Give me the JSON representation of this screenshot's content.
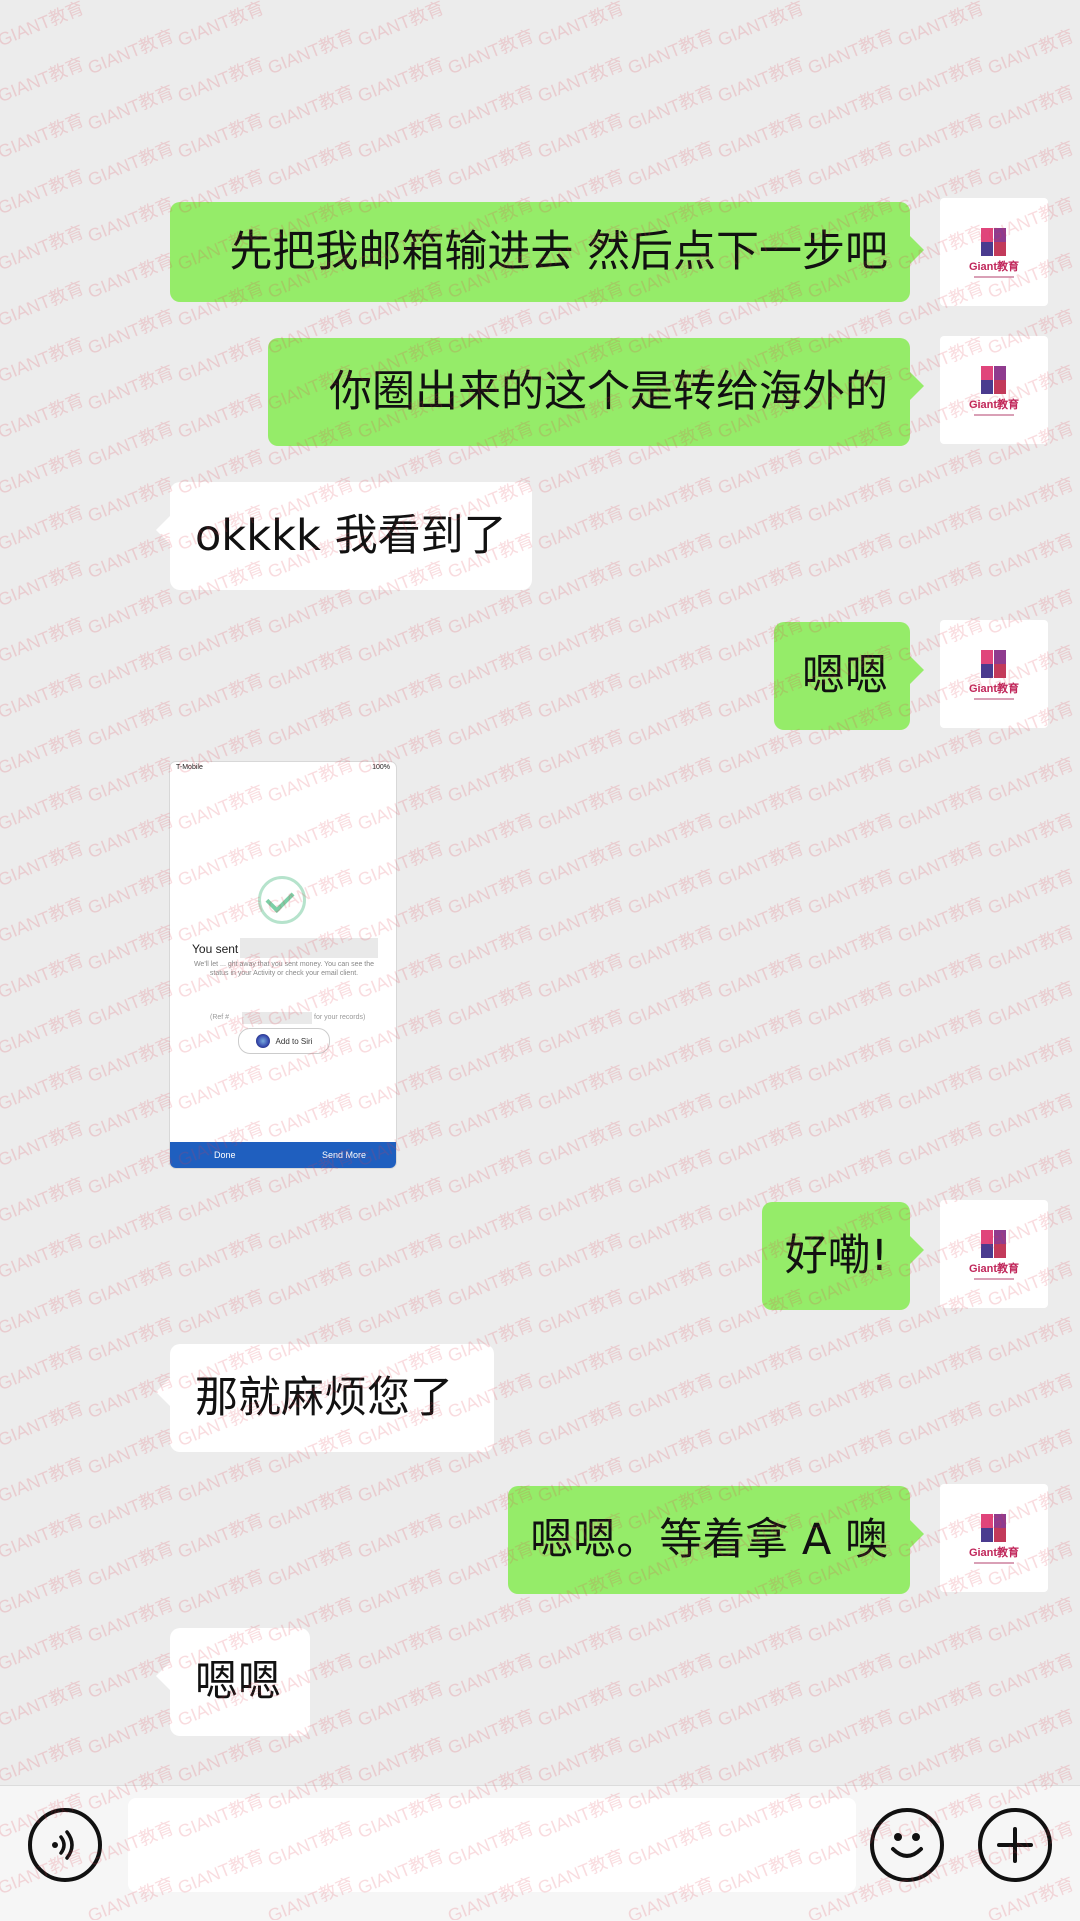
{
  "messages": [
    {
      "side": "right",
      "text": "先把我邮箱输进去 然后点下一步吧"
    },
    {
      "side": "right",
      "text": "你圈出来的这个是转给海外的"
    },
    {
      "side": "left",
      "text": "okkkk 我看到了"
    },
    {
      "side": "right",
      "text": "嗯嗯"
    },
    {
      "side": "left",
      "type": "image"
    },
    {
      "side": "right",
      "text": "好嘞!"
    },
    {
      "side": "left",
      "text": "那就麻烦您了"
    },
    {
      "side": "right",
      "text": "嗯嗯。等着拿 A 噢"
    },
    {
      "side": "left",
      "text": "嗯嗯"
    }
  ],
  "screenshot": {
    "status_carrier": "T-Mobile",
    "status_battery": "100%",
    "sent_label": "You sent",
    "body_text": "We'll let ... ght away that you sent money. You can see the status in your Activity or check your email client.",
    "ref_left": "(Ref #",
    "ref_right": "for your records)",
    "siri_label": "Add to Siri",
    "done_label": "Done",
    "send_more_label": "Send More"
  },
  "avatar": {
    "logo_text": "Giant教育"
  },
  "watermark_text": "GIANT教育",
  "colors": {
    "sent_bubble": "#95ec69",
    "received_bubble": "#ffffff",
    "chat_bg": "#ececec"
  },
  "bottom_bar": {
    "voice_icon": "voice-icon",
    "emoji_icon": "emoji-icon",
    "plus_icon": "plus-icon"
  }
}
